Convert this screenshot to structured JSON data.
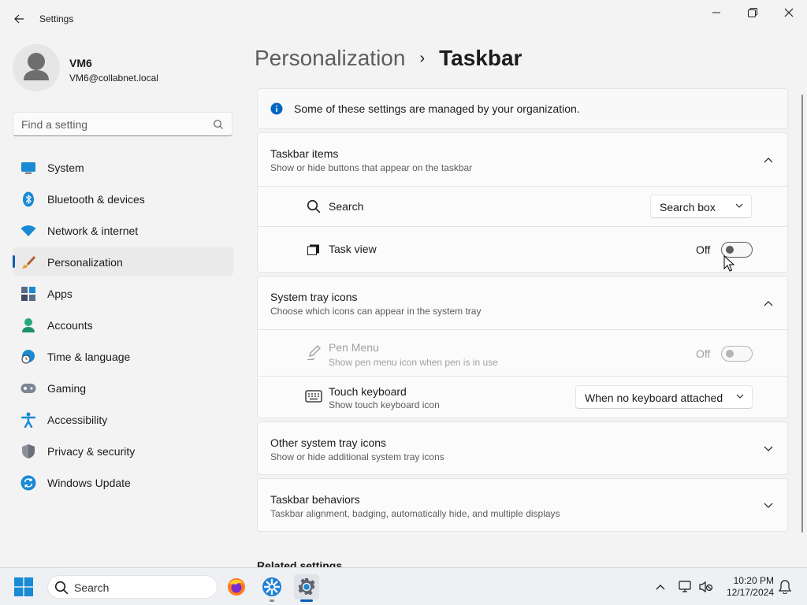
{
  "app": {
    "title": "Settings"
  },
  "user": {
    "name": "VM6",
    "email": "VM6@collabnet.local"
  },
  "search": {
    "placeholder": "Find a setting"
  },
  "sidebar": {
    "items": [
      {
        "label": "System",
        "icon": "system-icon"
      },
      {
        "label": "Bluetooth & devices",
        "icon": "bluetooth-icon"
      },
      {
        "label": "Network & internet",
        "icon": "wifi-icon"
      },
      {
        "label": "Personalization",
        "icon": "paintbrush-icon",
        "selected": true
      },
      {
        "label": "Apps",
        "icon": "apps-icon"
      },
      {
        "label": "Accounts",
        "icon": "person-icon"
      },
      {
        "label": "Time & language",
        "icon": "globe-clock-icon"
      },
      {
        "label": "Gaming",
        "icon": "gamepad-icon"
      },
      {
        "label": "Accessibility",
        "icon": "accessibility-icon"
      },
      {
        "label": "Privacy & security",
        "icon": "shield-icon"
      },
      {
        "label": "Windows Update",
        "icon": "update-icon"
      }
    ]
  },
  "breadcrumb": {
    "parent": "Personalization",
    "current": "Taskbar"
  },
  "info": {
    "text": "Some of these settings are managed by your organization."
  },
  "taskbar_items": {
    "title": "Taskbar items",
    "subtitle": "Show or hide buttons that appear on the taskbar",
    "search": {
      "label": "Search",
      "value": "Search box"
    },
    "task_view": {
      "label": "Task view",
      "state": "Off"
    }
  },
  "system_tray": {
    "title": "System tray icons",
    "subtitle": "Choose which icons can appear in the system tray",
    "pen_menu": {
      "label": "Pen Menu",
      "subtitle": "Show pen menu icon when pen is in use",
      "state": "Off"
    },
    "touch_keyboard": {
      "label": "Touch keyboard",
      "subtitle": "Show touch keyboard icon",
      "value": "When no keyboard attached"
    }
  },
  "other_tray": {
    "title": "Other system tray icons",
    "subtitle": "Show or hide additional system tray icons"
  },
  "behaviors": {
    "title": "Taskbar behaviors",
    "subtitle": "Taskbar alignment, badging, automatically hide, and multiple displays"
  },
  "related": {
    "title": "Related settings"
  },
  "os_taskbar": {
    "search_label": "Search",
    "time": "10:20 PM",
    "date": "12/17/2024"
  },
  "colors": {
    "accent": "#005fb8",
    "info": "#0067c0"
  }
}
